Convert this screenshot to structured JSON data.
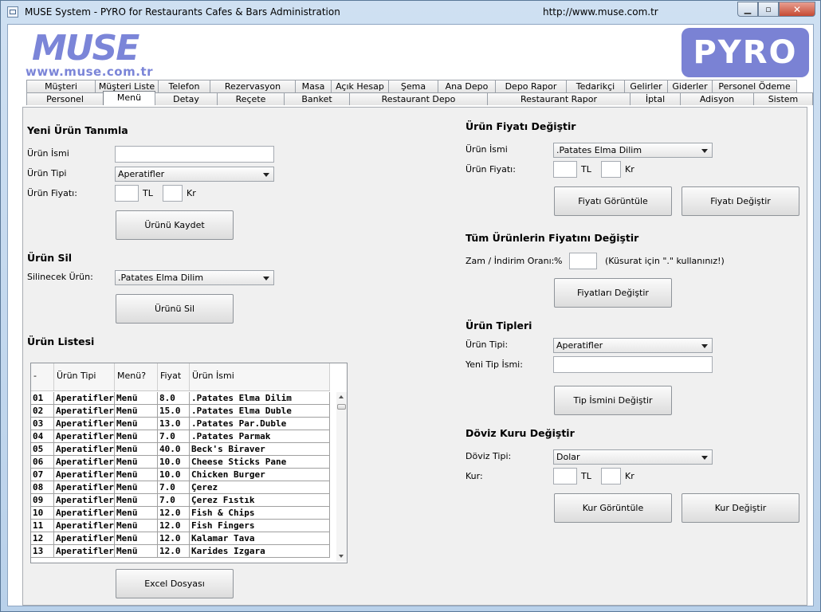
{
  "window": {
    "title": "MUSE System - PYRO for Restaurants Cafes & Bars Administration",
    "url": "http://www.muse.com.tr",
    "controls": {
      "minimize": "▁",
      "maximize": "▫",
      "close": "✕"
    }
  },
  "header": {
    "logo_text": "MUSE",
    "logo_url": "www.muse.com.tr",
    "brand": "PYRO",
    "accent": "#7b85d8"
  },
  "tabs": {
    "row1": [
      "Müşteri",
      "Müşteri Liste",
      "Telefon",
      "Rezervasyon",
      "Masa",
      "Açık Hesap",
      "Şema",
      "Ana Depo",
      "Depo Rapor",
      "Tedarikçi",
      "Gelirler",
      "Giderler",
      "Personel Ödeme"
    ],
    "row2": [
      "Personel",
      "Menü",
      "Detay",
      "Reçete",
      "Banket",
      "Restaurant Depo",
      "Restaurant Rapor",
      "İptal",
      "Adisyon",
      "Sistem"
    ],
    "selected": "Menü"
  },
  "new_product": {
    "title": "Yeni Ürün Tanımla",
    "name_label": "Ürün İsmi",
    "name_value": "",
    "type_label": "Ürün Tipi",
    "type_value": "Aperatifler",
    "price_label": "Ürün Fiyatı:",
    "tl": "TL",
    "kr": "Kr",
    "save_button": "Ürünü Kaydet"
  },
  "delete_product": {
    "title": "Ürün Sil",
    "label": "Silinecek Ürün:",
    "value": ".Patates Elma Dilim",
    "button": "Ürünü Sil"
  },
  "product_list": {
    "title": "Ürün Listesi",
    "columns": [
      "-",
      "Ürün Tipi",
      "Menü?",
      "Fiyat",
      "Ürün İsmi"
    ],
    "rows": [
      [
        "01",
        "Aperatifler",
        "Menü",
        "8.0",
        ".Patates Elma Dilim"
      ],
      [
        "02",
        "Aperatifler",
        "Menü",
        "15.0",
        ".Patates Elma Duble"
      ],
      [
        "03",
        "Aperatifler",
        "Menü",
        "13.0",
        ".Patates Par.Duble"
      ],
      [
        "04",
        "Aperatifler",
        "Menü",
        "7.0",
        ".Patates Parmak"
      ],
      [
        "05",
        "Aperatifler",
        "Menü",
        "40.0",
        "Beck's Biraver"
      ],
      [
        "06",
        "Aperatifler",
        "Menü",
        "10.0",
        "Cheese Sticks Pane"
      ],
      [
        "07",
        "Aperatifler",
        "Menü",
        "10.0",
        "Chicken Burger"
      ],
      [
        "08",
        "Aperatifler",
        "Menü",
        "7.0",
        "Çerez"
      ],
      [
        "09",
        "Aperatifler",
        "Menü",
        "7.0",
        "Çerez Fıstık"
      ],
      [
        "10",
        "Aperatifler",
        "Menü",
        "12.0",
        "Fish & Chips"
      ],
      [
        "11",
        "Aperatifler",
        "Menü",
        "12.0",
        "Fish Fingers"
      ],
      [
        "12",
        "Aperatifler",
        "Menü",
        "12.0",
        "Kalamar Tava"
      ],
      [
        "13",
        "Aperatifler",
        "Menü",
        "12.0",
        "Karides Izgara"
      ]
    ],
    "excel_button": "Excel Dosyası"
  },
  "change_price": {
    "title": "Ürün Fiyatı Değiştir",
    "name_label": "Ürün İsmi",
    "name_value": ".Patates Elma Dilim",
    "price_label": "Ürün Fiyatı:",
    "tl": "TL",
    "kr": "Kr",
    "view_button": "Fiyatı Görüntüle",
    "change_button": "Fiyatı Değiştir"
  },
  "all_prices": {
    "title": "Tüm Ürünlerin Fiyatını Değiştir",
    "label": "Zam / İndirim Oranı:",
    "percent": "%",
    "hint": "(Küsurat için \".\" kullanınız!)",
    "button": "Fiyatları Değiştir"
  },
  "product_types": {
    "title": "Ürün Tipleri",
    "type_label": "Ürün Tipi:",
    "type_value": "Aperatifler",
    "new_name_label": "Yeni Tip İsmi:",
    "button": "Tip İsmini Değiştir"
  },
  "currency": {
    "title": "Döviz Kuru Değiştir",
    "type_label": "Döviz Tipi:",
    "type_value": "Dolar",
    "rate_label": "Kur:",
    "tl": "TL",
    "kr": "Kr",
    "view_button": "Kur Görüntüle",
    "change_button": "Kur Değiştir"
  }
}
